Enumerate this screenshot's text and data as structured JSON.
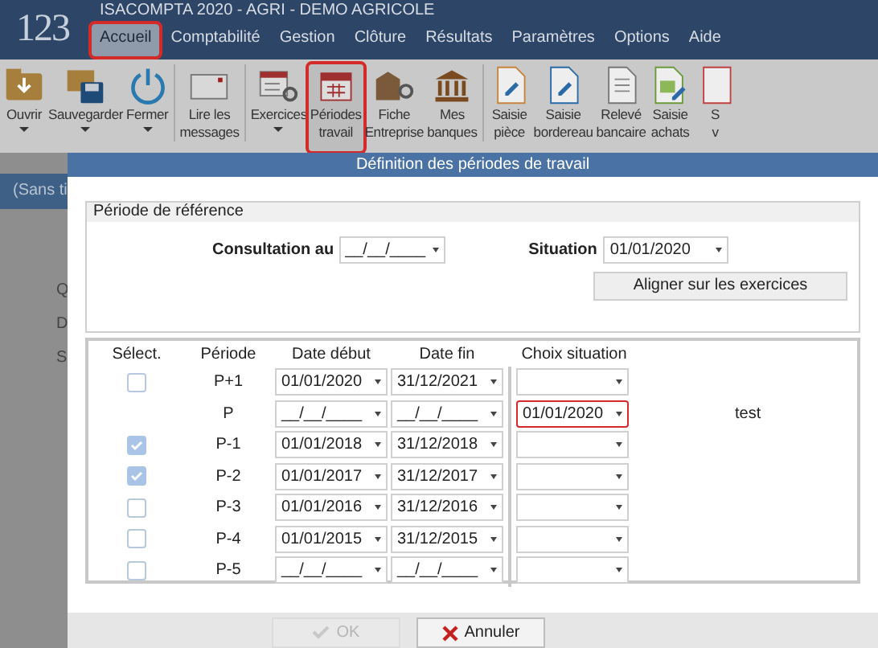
{
  "app": {
    "logo": "123",
    "title": "ISACOMPTA 2020 - AGRI - DEMO AGRICOLE"
  },
  "menu": [
    {
      "label": "Accueil",
      "selected": true,
      "highlighted": true
    },
    {
      "label": "Comptabilité",
      "selected": false,
      "highlighted": false
    },
    {
      "label": "Gestion",
      "selected": false,
      "highlighted": false
    },
    {
      "label": "Clôture",
      "selected": false,
      "highlighted": false
    },
    {
      "label": "Résultats",
      "selected": false,
      "highlighted": false
    },
    {
      "label": "Paramètres",
      "selected": false,
      "highlighted": false
    },
    {
      "label": "Options",
      "selected": false,
      "highlighted": false
    },
    {
      "label": "Aide",
      "selected": false,
      "highlighted": false
    }
  ],
  "ribbon": [
    {
      "kind": "open",
      "label": [
        "Ouvrir"
      ],
      "dropdown": true,
      "highlighted": false
    },
    {
      "kind": "save",
      "label": [
        "Sauvegarder"
      ],
      "dropdown": true,
      "highlighted": false
    },
    {
      "kind": "power",
      "label": [
        "Fermer"
      ],
      "dropdown": true,
      "highlighted": false
    },
    {
      "kind": "mail",
      "label": [
        "Lire les",
        "messages"
      ],
      "dropdown": false,
      "highlighted": false
    },
    {
      "kind": "calendar-gear",
      "label": [
        "Exercices"
      ],
      "dropdown": true,
      "highlighted": false
    },
    {
      "kind": "calendar",
      "label": [
        "Périodes",
        "travail"
      ],
      "dropdown": false,
      "highlighted": true
    },
    {
      "kind": "building",
      "label": [
        "Fiche",
        "Entreprise"
      ],
      "dropdown": false,
      "highlighted": false
    },
    {
      "kind": "bank",
      "label": [
        "Mes",
        "banques"
      ],
      "dropdown": false,
      "highlighted": false
    },
    {
      "kind": "doc-orange",
      "label": [
        "Saisie",
        "pièce"
      ],
      "dropdown": false,
      "highlighted": false
    },
    {
      "kind": "doc-blue",
      "label": [
        "Saisie",
        "bordereau"
      ],
      "dropdown": false,
      "highlighted": false
    },
    {
      "kind": "doc-grey",
      "label": [
        "Relevé",
        "bancaire"
      ],
      "dropdown": false,
      "highlighted": false
    },
    {
      "kind": "doc-green",
      "label": [
        "Saisie",
        "achats"
      ],
      "dropdown": false,
      "highlighted": false
    },
    {
      "kind": "doc-red",
      "label": [
        "S",
        "v"
      ],
      "dropdown": false,
      "highlighted": false
    }
  ],
  "background": {
    "tab": "(Sans ti",
    "letters": [
      "Q",
      "D",
      "S"
    ]
  },
  "dialog": {
    "title": "Définition des périodes de travail",
    "reference": {
      "legend": "Période de référence",
      "consultation_label": "Consultation au",
      "consultation_value": "__/__/____",
      "situation_label": "Situation",
      "situation_value": "01/01/2020",
      "align_button": "Aligner sur les exercices"
    },
    "table": {
      "columns": [
        "Sélect.",
        "Période",
        "Date début",
        "Date fin",
        "Choix situation"
      ],
      "rows": [
        {
          "checked": false,
          "period": "P+1",
          "start": "01/01/2020",
          "end": "31/12/2021",
          "situation": "",
          "highlighted": false
        },
        {
          "period": "P",
          "start": "__/__/____",
          "end": "__/__/____",
          "situation": "01/01/2020",
          "highlighted": true,
          "note": "test"
        },
        {
          "checked": true,
          "period": "P-1",
          "start": "01/01/2018",
          "end": "31/12/2018",
          "situation": "",
          "highlighted": false
        },
        {
          "checked": true,
          "period": "P-2",
          "start": "01/01/2017",
          "end": "31/12/2017",
          "situation": "",
          "highlighted": false
        },
        {
          "checked": false,
          "period": "P-3",
          "start": "01/01/2016",
          "end": "31/12/2016",
          "situation": "",
          "highlighted": false
        },
        {
          "checked": false,
          "period": "P-4",
          "start": "01/01/2015",
          "end": "31/12/2015",
          "situation": "",
          "highlighted": false
        },
        {
          "checked": false,
          "period": "P-5",
          "start": "__/__/____",
          "end": "__/__/____",
          "situation": "",
          "highlighted": false
        }
      ]
    },
    "buttons": [
      {
        "kind": "ok",
        "label": "OK",
        "disabled": true
      },
      {
        "kind": "cancel",
        "label": "Annuler",
        "disabled": false
      }
    ]
  }
}
